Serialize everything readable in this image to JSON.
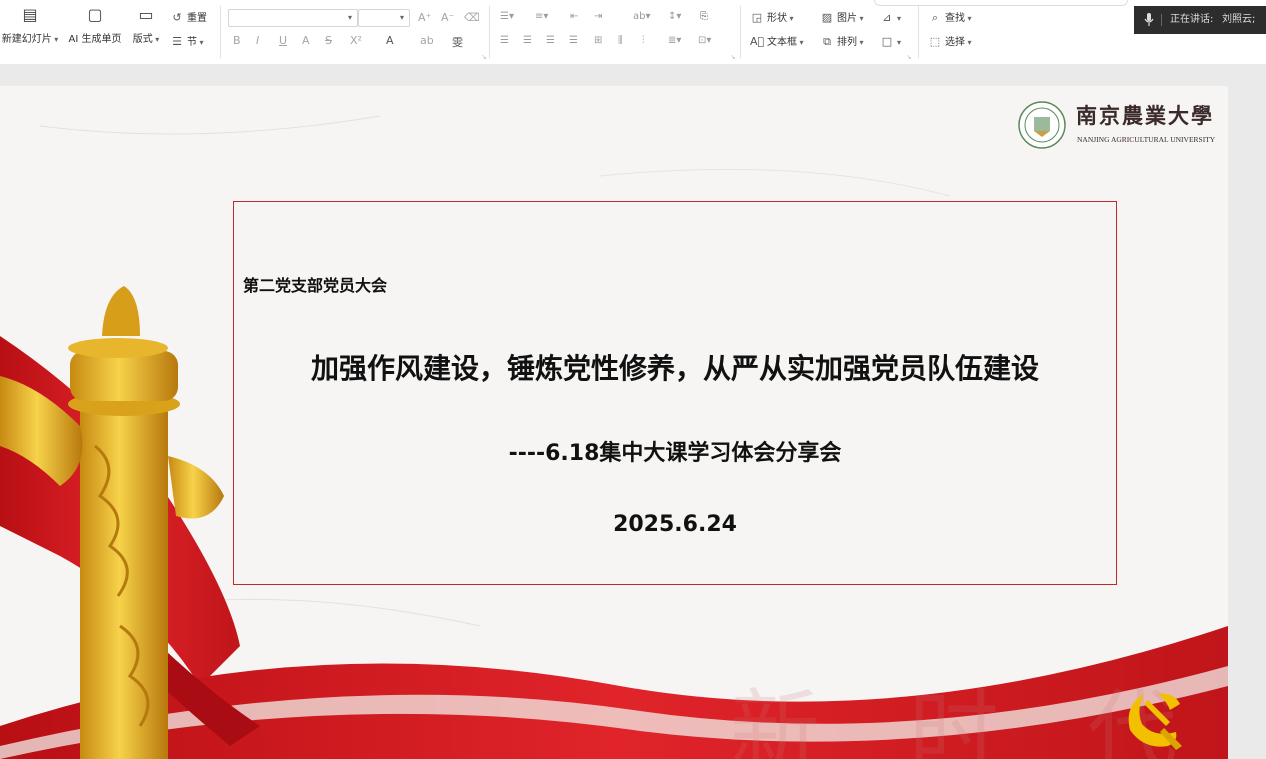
{
  "toolbar": {
    "new_slide": "新建幻灯片",
    "ai_page": "AI 生成单页",
    "layout": "版式",
    "reset": "重置",
    "section": "节",
    "format_labels": [
      "B",
      "I",
      "U",
      "A",
      "S",
      "X²",
      "A",
      "ab",
      "雯"
    ],
    "shape": "形状",
    "picture": "图片",
    "textbox": "文本框",
    "arrange": "排列",
    "find": "查找",
    "select": "选择"
  },
  "speaking": {
    "label": "正在讲话:",
    "name": "刘照云;"
  },
  "slide": {
    "school_name_cn": "南京農業大學",
    "school_name_en": "NANJING AGRICULTURAL UNIVERSITY",
    "meeting": "第二党支部党员大会",
    "title": "加强作风建设，锤炼党性修养，从严从实加强党员队伍建设",
    "subtitle": "----6.18集中大课学习体会分享会",
    "date": "2025.6.24",
    "watermark": "新 时 代"
  },
  "icons": [
    "new-slide-icon",
    "ai-page-icon",
    "layout-icon",
    "reset-icon",
    "section-icon",
    "bullet-list-icon",
    "numbered-list-icon",
    "shape-icon",
    "picture-icon",
    "textbox-icon",
    "arrange-icon",
    "search-icon",
    "select-icon",
    "microphone-icon",
    "party-emblem-icon"
  ],
  "colors": {
    "frame_red": "#c0282b",
    "ribbon_red": "#d71920",
    "pillar_gold": "#e8b923"
  }
}
